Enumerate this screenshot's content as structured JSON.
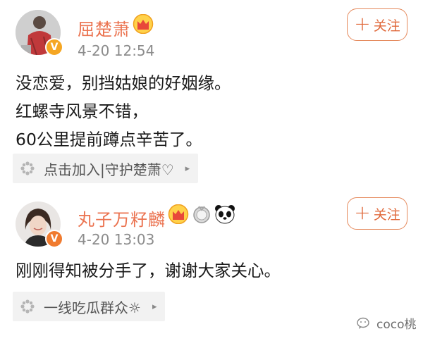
{
  "posts": [
    {
      "username": "屈楚萧",
      "timestamp": "4-20 12:54",
      "follow_label": "关注",
      "content_lines": [
        "没恋爱，别挡姑娘的好姻缘。",
        "红螺寺风景不错，",
        "60公里提前蹲点辛苦了。"
      ],
      "source": "点击加入|守护楚萧♡"
    },
    {
      "username": "丸子万籽麟",
      "timestamp": "4-20 13:03",
      "follow_label": "关注",
      "content_lines": [
        "刚刚得知被分手了，谢谢大家关心。"
      ],
      "source": "一线吃瓜群众☼"
    }
  ],
  "watermark": "coco桃",
  "colors": {
    "username": "#eb7350",
    "follow_border": "#e58a5d",
    "verified_yellow": "#f5a623",
    "verified_orange": "#f07b2f"
  },
  "icons": {
    "crown": "crown-icon",
    "medal": "medal-icon",
    "panda": "panda-icon",
    "source": "pinwheel-icon"
  }
}
